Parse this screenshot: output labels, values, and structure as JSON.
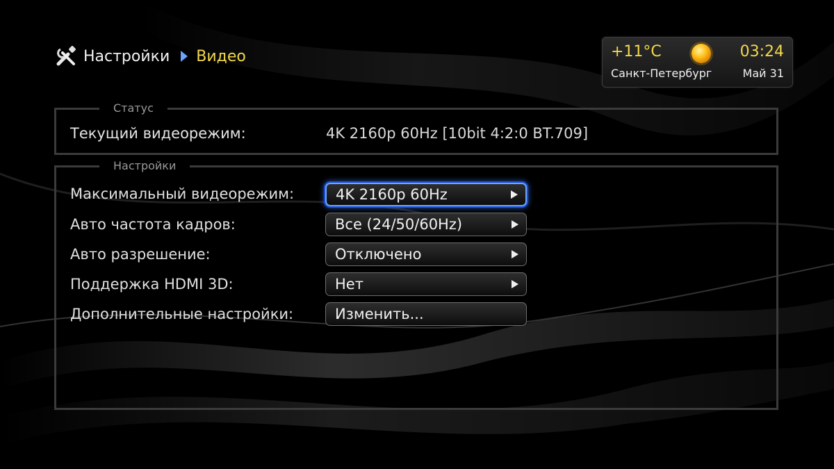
{
  "breadcrumb": {
    "root_icon": "tools-icon",
    "root": "Настройки",
    "separator_icon": "chevron-right-icon",
    "current": "Видео"
  },
  "info": {
    "temperature": "+11°C",
    "weather_icon": "sun-icon",
    "time": "03:24",
    "city": "Санкт-Петербург",
    "date": "Май 31"
  },
  "status_group": {
    "legend": "Статус",
    "label": "Текущий видеорежим:",
    "value": "4K 2160p 60Hz [10bit 4:2:0 BT.709]"
  },
  "settings_group": {
    "legend": "Настройки",
    "rows": [
      {
        "label": "Максимальный видеорежим:",
        "value": "4K 2160p 60Hz",
        "has_arrow": true,
        "focused": true
      },
      {
        "label": "Авто частота кадров:",
        "value": "Все (24/50/60Hz)",
        "has_arrow": true,
        "focused": false
      },
      {
        "label": "Авто разрешение:",
        "value": "Отключено",
        "has_arrow": true,
        "focused": false
      },
      {
        "label": "Поддержка HDMI 3D:",
        "value": "Нет",
        "has_arrow": true,
        "focused": false
      },
      {
        "label": "Дополнительные настройки:",
        "value": "Изменить...",
        "has_arrow": false,
        "focused": false
      }
    ]
  },
  "colors": {
    "accent_yellow": "#f3d84a",
    "focus_blue": "#1d4fd1"
  }
}
